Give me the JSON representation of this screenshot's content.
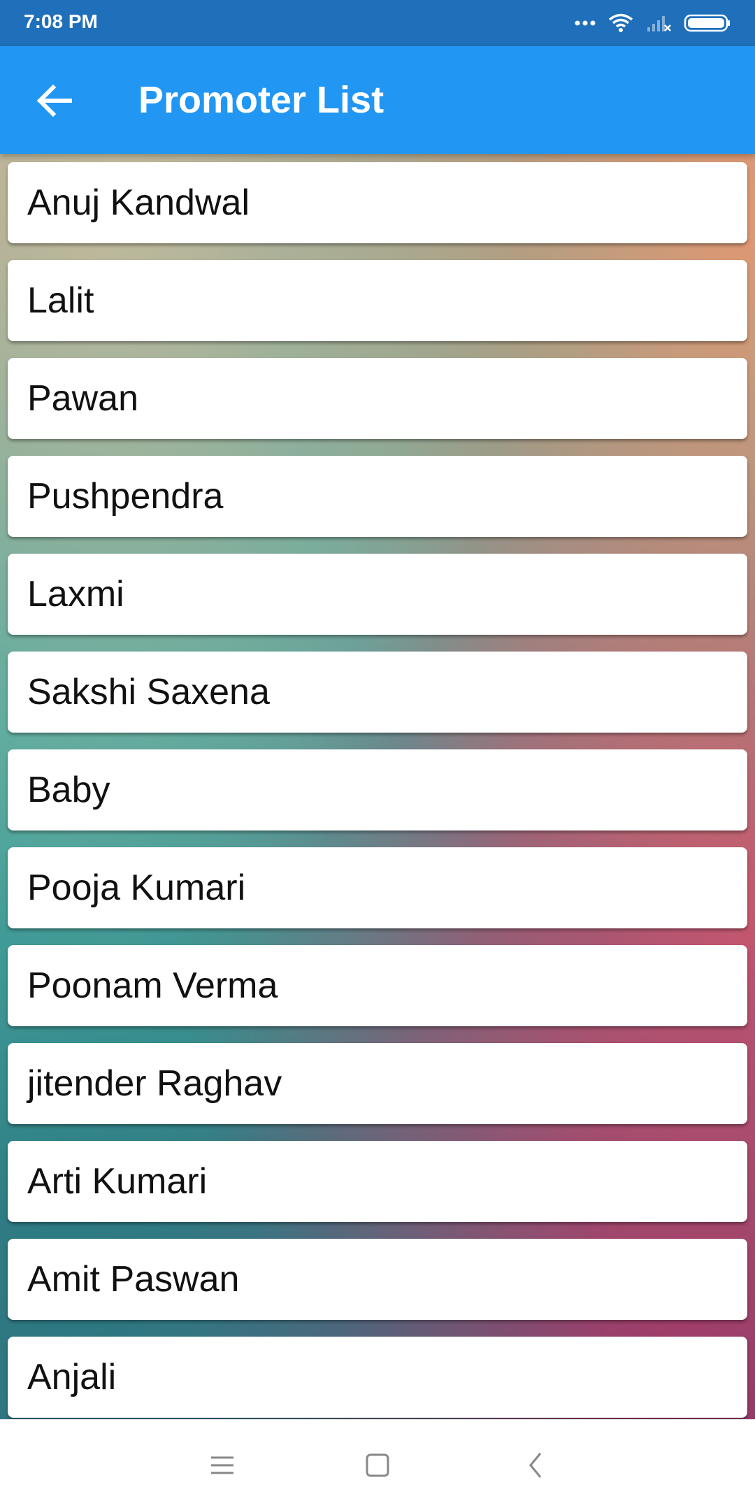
{
  "status_bar": {
    "time": "7:08 PM",
    "icons": [
      "more-dots-icon",
      "wifi-icon",
      "signal-icon",
      "battery-icon"
    ]
  },
  "app_bar": {
    "back_icon": "arrow-left-icon",
    "title": "Promoter List",
    "color": "#2196f3"
  },
  "promoters": [
    "Anuj Kandwal",
    "Lalit",
    "Pawan",
    "Pushpendra",
    "Laxmi",
    "Sakshi Saxena",
    "Baby",
    "Pooja Kumari",
    "Poonam Verma",
    "jitender Raghav",
    "Arti Kumari",
    "Amit Paswan",
    "Anjali"
  ],
  "nav_bar": {
    "icons": [
      "menu-icon",
      "home-square-icon",
      "back-chevron-icon"
    ]
  }
}
